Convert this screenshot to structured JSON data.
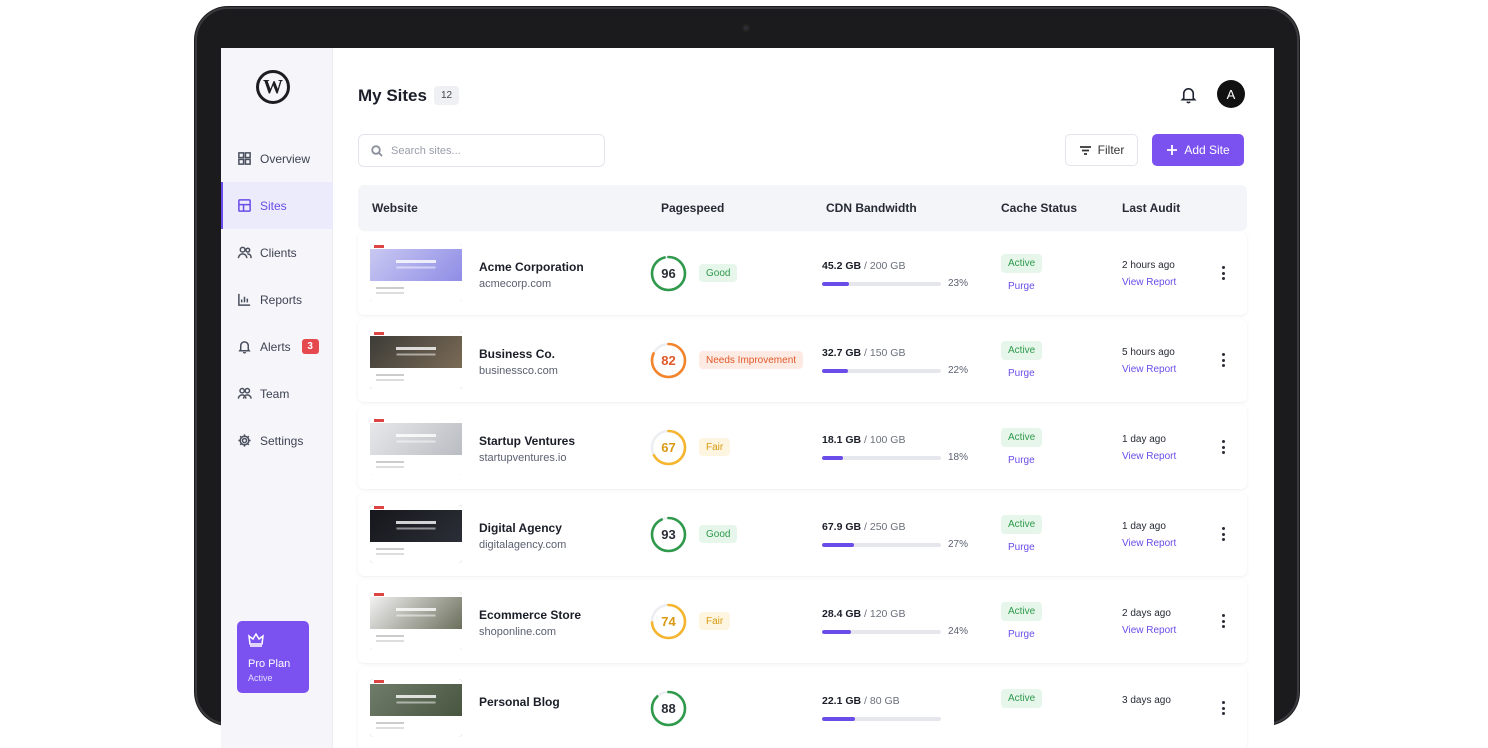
{
  "sidebar": {
    "logo_glyph": "W",
    "items": [
      {
        "label": "Overview",
        "icon": "grid-icon",
        "active": false
      },
      {
        "label": "Sites",
        "icon": "layout-icon",
        "active": true
      },
      {
        "label": "Clients",
        "icon": "users-icon",
        "active": false
      },
      {
        "label": "Reports",
        "icon": "chart-icon",
        "active": false
      },
      {
        "label": "Alerts",
        "icon": "bell-icon",
        "active": false,
        "badge": "3"
      },
      {
        "label": "Team",
        "icon": "team-icon",
        "active": false
      },
      {
        "label": "Settings",
        "icon": "gear-icon",
        "active": false
      }
    ],
    "plan": {
      "title": "Pro Plan",
      "status": "Active",
      "icon": "crown-icon"
    }
  },
  "header": {
    "title": "My Sites",
    "count": "12",
    "avatar_initial": "A"
  },
  "toolbar": {
    "search_placeholder": "Search sites...",
    "filter_label": "Filter",
    "add_label": "Add Site"
  },
  "table": {
    "columns": [
      "Website",
      "Pagespeed",
      "CDN Bandwidth",
      "Cache Status",
      "Last Audit"
    ],
    "rows": [
      {
        "name": "Acme Corporation",
        "url": "acmecorp.com",
        "score": "96",
        "score_pct": 96,
        "rating": "Good",
        "bw_used": "45.2 GB",
        "bw_total": " / 200 GB",
        "bw_pct": "23%",
        "bw_frac": 0.23,
        "cache": "Active",
        "purge": "Purge",
        "audit": "2 hours ago",
        "report": "View Report",
        "thumb": [
          "#c9c8f2",
          "#8f8de6"
        ],
        "tone": "good"
      },
      {
        "name": "Business Co.",
        "url": "businessco.com",
        "score": "82",
        "score_pct": 82,
        "rating": "Needs Improvement",
        "bw_used": "32.7 GB",
        "bw_total": " / 150 GB",
        "bw_pct": "22%",
        "bw_frac": 0.22,
        "cache": "Active",
        "purge": "Purge",
        "audit": "5 hours ago",
        "report": "View Report",
        "thumb": [
          "#3d3c38",
          "#7a6a55"
        ],
        "tone": "needs"
      },
      {
        "name": "Startup Ventures",
        "url": "startupventures.io",
        "score": "67",
        "score_pct": 67,
        "rating": "Fair",
        "bw_used": "18.1 GB",
        "bw_total": " / 100 GB",
        "bw_pct": "18%",
        "bw_frac": 0.18,
        "cache": "Active",
        "purge": "Purge",
        "audit": "1 day ago",
        "report": "View Report",
        "thumb": [
          "#e7e8ea",
          "#b9bcc2"
        ],
        "tone": "fair"
      },
      {
        "name": "Digital Agency",
        "url": "digitalagency.com",
        "score": "93",
        "score_pct": 93,
        "rating": "Good",
        "bw_used": "67.9 GB",
        "bw_total": " / 250 GB",
        "bw_pct": "27%",
        "bw_frac": 0.27,
        "cache": "Active",
        "purge": "Purge",
        "audit": "1 day ago",
        "report": "View Report",
        "thumb": [
          "#15171c",
          "#2b2e36"
        ],
        "tone": "good"
      },
      {
        "name": "Ecommerce Store",
        "url": "shoponline.com",
        "score": "74",
        "score_pct": 74,
        "rating": "Fair",
        "bw_used": "28.4 GB",
        "bw_total": " / 120 GB",
        "bw_pct": "24%",
        "bw_frac": 0.24,
        "cache": "Active",
        "purge": "Purge",
        "audit": "2 days ago",
        "report": "View Report",
        "thumb": [
          "#f2f2f2",
          "#6b6f5c"
        ],
        "tone": "fair"
      },
      {
        "name": "Personal Blog",
        "url": "",
        "score": "88",
        "score_pct": 88,
        "rating": "",
        "bw_used": "22.1 GB",
        "bw_total": " / 80 GB",
        "bw_pct": "",
        "bw_frac": 0.28,
        "cache": "Active",
        "purge": "",
        "audit": "3 days ago",
        "report": "",
        "thumb": [
          "#6f7c6a",
          "#48553f"
        ],
        "tone": "good"
      }
    ]
  },
  "colors": {
    "accent": "#7b52f0",
    "good": "#2f9a4c",
    "good_bg": "#e6f6ea",
    "needs": "#f2842c",
    "needs_bg": "#fdebe3",
    "needs_text": "#e0582a",
    "fair": "#f5b52e",
    "fair_bg": "#fdf5df",
    "fair_text": "#d99a12"
  }
}
